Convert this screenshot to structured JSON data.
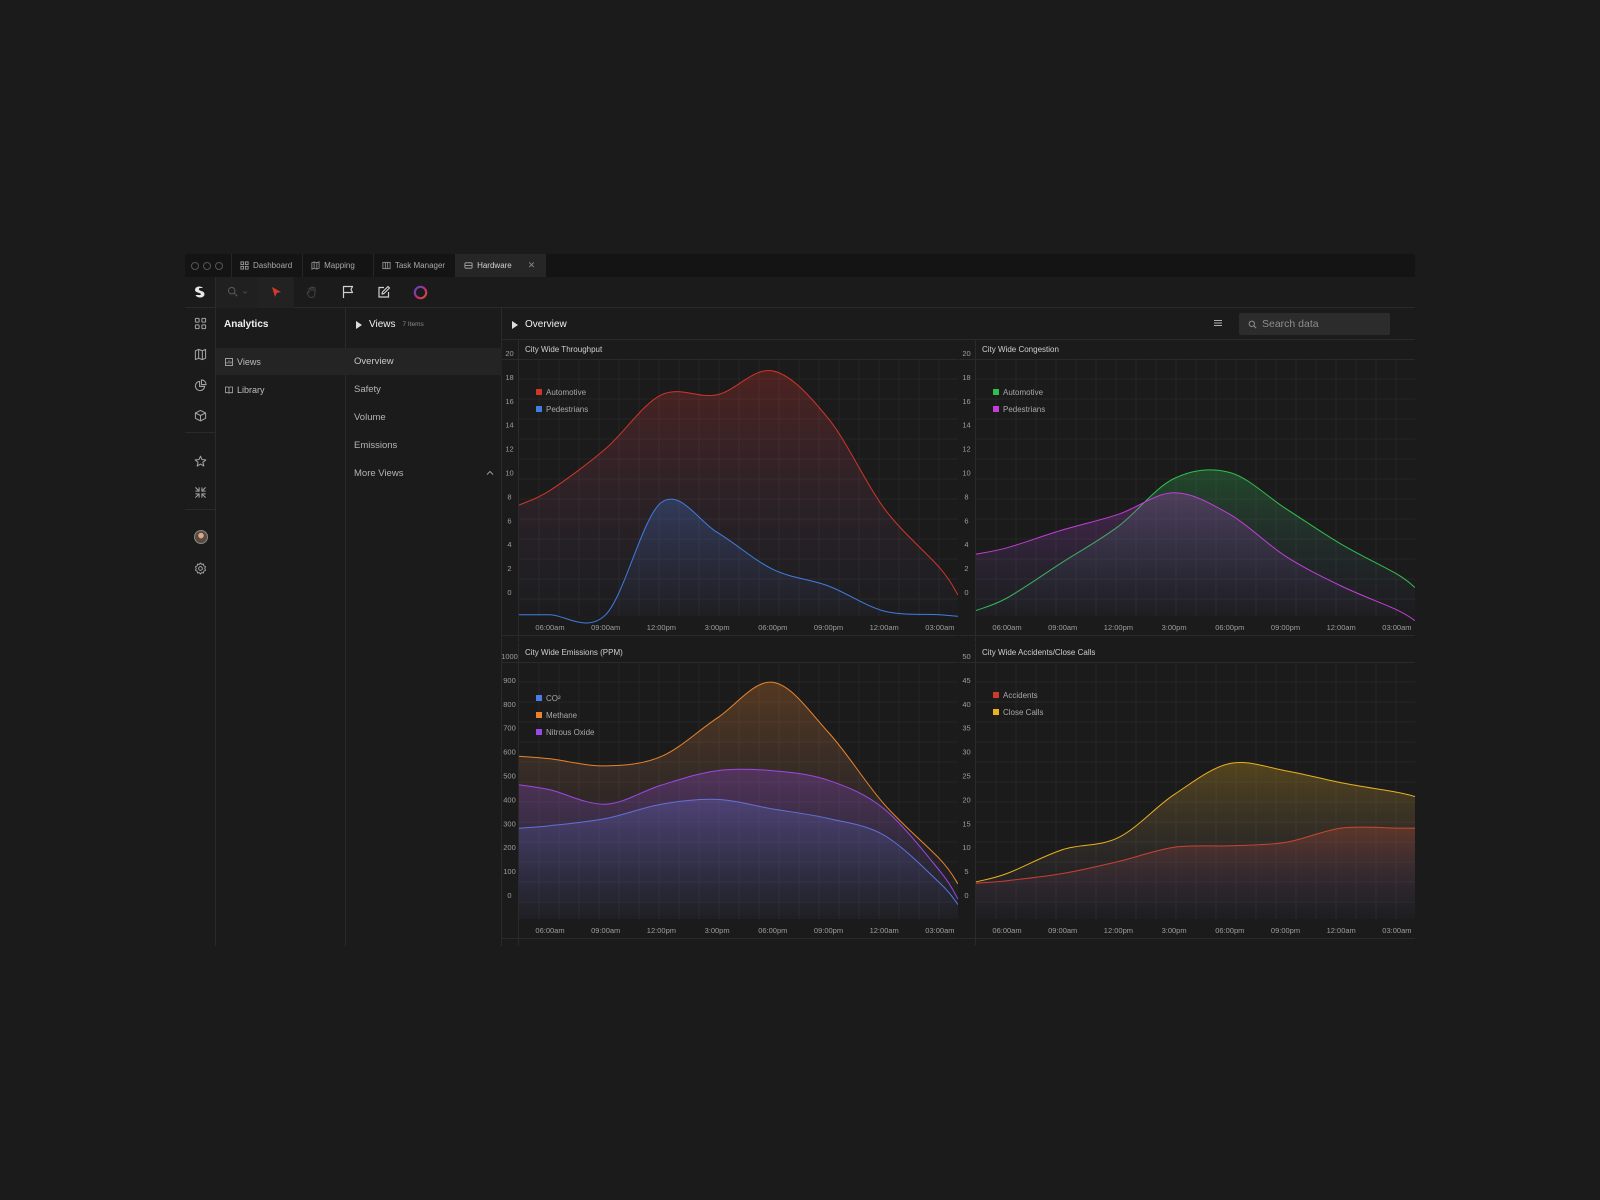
{
  "tabs": [
    {
      "label": "Dashboard",
      "icon": "grid-icon"
    },
    {
      "label": "Mapping",
      "icon": "map-icon"
    },
    {
      "label": "Task Manager",
      "icon": "columns-icon"
    },
    {
      "label": "Hardware",
      "icon": "hardware-icon",
      "active": true
    }
  ],
  "toolbar": {
    "tools": [
      "zoom-icon",
      "pointer-icon",
      "hand-icon",
      "flag-icon",
      "edit-icon",
      "color-wheel-icon"
    ],
    "active_tool": "pointer-icon",
    "accent": "#d23a2f"
  },
  "rail": {
    "icons": [
      "grid-icon",
      "map-icon",
      "pie-chart-icon",
      "cube-icon",
      "star-icon",
      "shrink-icon",
      "avatar",
      "gear-icon"
    ],
    "active": "pie-chart-icon"
  },
  "analytics": {
    "title": "Analytics",
    "items": [
      {
        "label": "Views",
        "icon": "views-icon",
        "active": true
      },
      {
        "label": "Library",
        "icon": "book-icon"
      }
    ]
  },
  "views": {
    "title": "Views",
    "count": "7 Items",
    "items": [
      {
        "label": "Overview",
        "active": true
      },
      {
        "label": "Safety"
      },
      {
        "label": "Volume"
      },
      {
        "label": "Emissions"
      },
      {
        "label": "More Views",
        "expandable": true
      }
    ]
  },
  "main": {
    "title": "Overview",
    "search_placeholder": "Search data"
  },
  "chart_data": [
    {
      "type": "area",
      "title": "City Wide Throughput",
      "x": [
        "06:00am",
        "09:00am",
        "12:00pm",
        "3:00pm",
        "06:00pm",
        "09:00pm",
        "12:00am",
        "03:00am"
      ],
      "ylim": [
        0,
        20
      ],
      "yticks": [
        0,
        2,
        4,
        6,
        8,
        10,
        12,
        14,
        16,
        18,
        20
      ],
      "grid": true,
      "legend": "top-left",
      "series": [
        {
          "name": "Automotive",
          "color": "#d0352b",
          "values": [
            8.5,
            12,
            16.5,
            16.5,
            18.5,
            14.5,
            7,
            2
          ]
        },
        {
          "name": "Pedestrians",
          "color": "#3f7de0",
          "values": [
            -1.9,
            -1.9,
            7.5,
            5,
            1.9,
            0.5,
            -1.6,
            -1.9
          ]
        }
      ]
    },
    {
      "type": "area",
      "title": "City Wide Congestion",
      "x": [
        "06:00am",
        "09:00am",
        "12:00pm",
        "3:00pm",
        "06:00pm",
        "09:00pm",
        "12:00am",
        "03:00am"
      ],
      "ylim": [
        0,
        20
      ],
      "yticks": [
        0,
        2,
        4,
        6,
        8,
        10,
        12,
        14,
        16,
        18,
        20
      ],
      "grid": true,
      "legend": "top-left",
      "series": [
        {
          "name": "Automotive",
          "color": "#2fbf4f",
          "values": [
            -0.5,
            2.5,
            5.5,
            9.5,
            10,
            7,
            4,
            1.5
          ]
        },
        {
          "name": "Pedestrians",
          "color": "#c23ed9",
          "values": [
            3.7,
            5.2,
            6.5,
            8.3,
            6.5,
            3,
            0.5,
            -1.5
          ]
        }
      ]
    },
    {
      "type": "area",
      "title": "City Wide Emissions (PPM)",
      "x": [
        "06:00am",
        "09:00am",
        "12:00pm",
        "3:00pm",
        "06:00pm",
        "09:00pm",
        "12:00am",
        "03:00am"
      ],
      "ylim": [
        0,
        1000
      ],
      "yticks": [
        0,
        100,
        200,
        300,
        400,
        500,
        600,
        700,
        800,
        900,
        1000
      ],
      "grid": true,
      "legend": "top-left",
      "series": [
        {
          "name": "CO²",
          "color": "#4f7bea",
          "values": [
            290,
            320,
            380,
            400,
            360,
            320,
            250,
            50
          ]
        },
        {
          "name": "Methane",
          "color": "#e8842c",
          "values": [
            570,
            540,
            580,
            740,
            890,
            680,
            380,
            150
          ]
        },
        {
          "name": "Nitrous Oxide",
          "color": "#9b48e6",
          "values": [
            440,
            380,
            460,
            520,
            520,
            480,
            360,
            100
          ]
        }
      ]
    },
    {
      "type": "area",
      "title": "City Wide Accidents/Close Calls",
      "x": [
        "06:00am",
        "09:00am",
        "12:00pm",
        "3:00pm",
        "06:00pm",
        "09:00pm",
        "12:00am",
        "03:00am"
      ],
      "ylim": [
        0,
        50
      ],
      "yticks": [
        0,
        5,
        10,
        15,
        20,
        25,
        30,
        35,
        40,
        45,
        50
      ],
      "grid": true,
      "legend": "top-left",
      "series": [
        {
          "name": "Accidents",
          "color": "#cf3a2c",
          "values": [
            3,
            4.5,
            7,
            10,
            10.3,
            11,
            14,
            14
          ]
        },
        {
          "name": "Close Calls",
          "color": "#eab11f",
          "values": [
            4.5,
            9.5,
            12,
            21,
            27.5,
            26,
            23.5,
            21.5
          ]
        }
      ]
    }
  ]
}
